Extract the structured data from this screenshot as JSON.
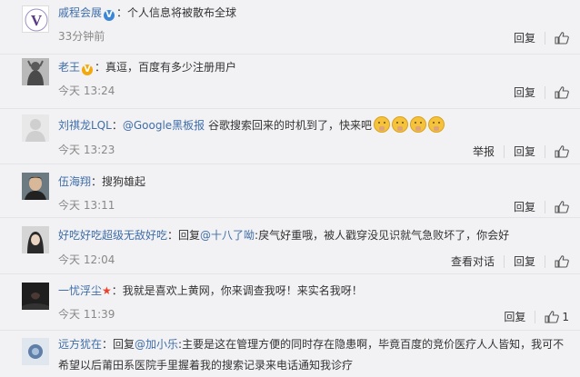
{
  "comments": [
    {
      "user": "戚程会展",
      "verified": "blue",
      "text": "：个人信息将被散布全球",
      "time": "33分钟前",
      "actions": [
        "回复"
      ]
    },
    {
      "user": "老王",
      "verified": "yellow",
      "text": "：真逗，百度有多少注册用户",
      "time": "今天 13:24",
      "actions": [
        "回复"
      ]
    },
    {
      "user": "刘祺龙LQL",
      "mention": "@Google黑板报",
      "prefix": "：",
      "text": " 谷歌搜索回来的时机到了，快来吧",
      "emoji_count": 4,
      "time": "今天 13:23",
      "actions": [
        "举报",
        "回复"
      ]
    },
    {
      "user": "伍海翔",
      "text": "：搜狗雄起",
      "time": "今天 13:11",
      "actions": [
        "回复"
      ]
    },
    {
      "user": "好吃好吃超级无敌好吃",
      "reply_prefix": "：回复",
      "mention": "@十八了呦",
      "text": ":戾气好重哦，被人戳穿没见识就气急败坏了，你会好",
      "time": "今天 12:04",
      "actions": [
        "查看对话",
        "回复"
      ]
    },
    {
      "user": "一忧浮尘",
      "text": "：我就是喜欢上黄网，你来调查我呀！来实名我呀！",
      "time": "今天 11:39",
      "actions": [
        "回复"
      ],
      "likes": "1"
    },
    {
      "user": "远方犹在",
      "reply_prefix": "：回复",
      "mention": "@加小乐",
      "text": ":主要是这在管理方便的同时存在隐患啊，毕竟百度的竞价医疗人人皆知，我可不",
      "text2": "希望以后莆田系医院手里握着我的搜索记录来电话通知我诊疗"
    }
  ],
  "colors": {
    "link": "#3f6ea8",
    "verified_blue": "#3b86d6",
    "verified_yellow": "#f3a80c",
    "star": "#e9412b"
  },
  "icons": [
    "thumbs-up-icon",
    "verified-badge-icon",
    "smiley-emoji-icon",
    "star-icon"
  ]
}
